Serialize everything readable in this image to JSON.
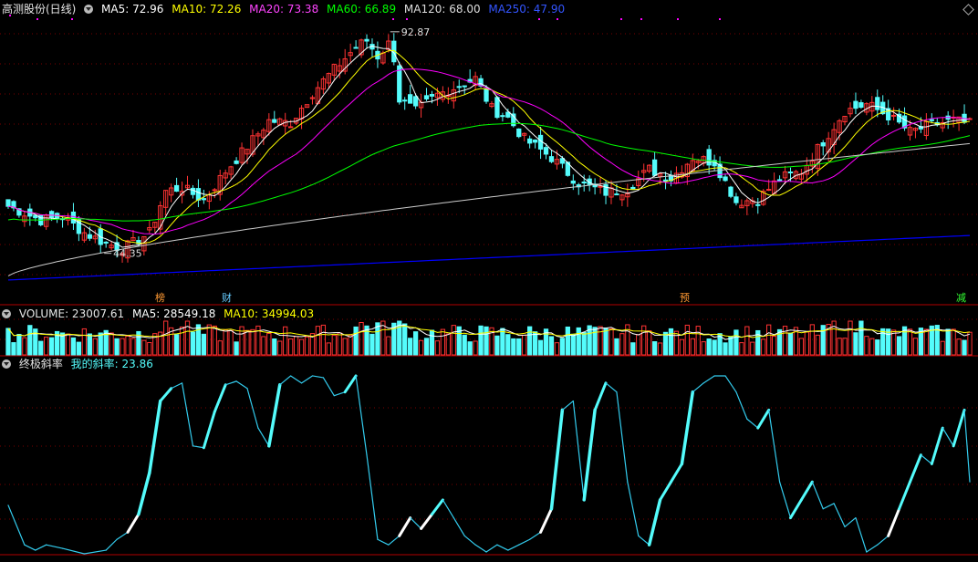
{
  "main_legend": {
    "title": "高测股份(日线)",
    "ma5": "MA5: 72.96",
    "ma10": "MA10: 72.26",
    "ma20": "MA20: 73.38",
    "ma60": "MA60: 66.89",
    "ma120": "MA120: 68.00",
    "ma250": "MA250: 47.90"
  },
  "volume_legend": {
    "volume": "VOLUME: 23007.61",
    "ma5": "MA5: 28549.18",
    "ma10": "MA10: 34994.03"
  },
  "indicator_legend": {
    "name": "终极斜率",
    "series": "我的斜率: 23.86"
  },
  "annotations": {
    "high": "92.87",
    "low": "44.35"
  },
  "events": [
    {
      "label": "榜",
      "color": "#ff9933"
    },
    {
      "label": "财",
      "color": "#66ccff"
    },
    {
      "label": "预",
      "color": "#ff9933"
    },
    {
      "label": "减",
      "color": "#33ff33"
    }
  ],
  "colors": {
    "up": "#ff3333",
    "down": "#54fcfc",
    "ma5": "#ffffff",
    "ma10": "#ffff00",
    "ma20": "#ff00ff",
    "ma60": "#00ff00",
    "ma120": "#cccccc",
    "ma250": "#0000ff",
    "indicator": "#33ccee",
    "indicator_strong": "#54fcfc",
    "grid": "#7a0000"
  },
  "chart_data": [
    {
      "type": "candlestick",
      "name": "高测股份(日线)",
      "high": 92.87,
      "low": 44.35,
      "moving_averages": {
        "MA5": 72.96,
        "MA10": 72.26,
        "MA20": 73.38,
        "MA60": 66.89,
        "MA120": 68.0,
        "MA250": 47.9
      },
      "close_path": [
        {
          "i": 0,
          "v": 54.5
        },
        {
          "i": 6,
          "v": 51.5
        },
        {
          "i": 10,
          "v": 52.2
        },
        {
          "i": 14,
          "v": 48.8
        },
        {
          "i": 18,
          "v": 46.5
        },
        {
          "i": 21,
          "v": 45.4
        },
        {
          "i": 23,
          "v": 46.6
        },
        {
          "i": 26,
          "v": 48.8
        },
        {
          "i": 29,
          "v": 57.8
        },
        {
          "i": 32,
          "v": 58.5
        },
        {
          "i": 36,
          "v": 55.8
        },
        {
          "i": 40,
          "v": 62.0
        },
        {
          "i": 44,
          "v": 67.4
        },
        {
          "i": 48,
          "v": 72.9
        },
        {
          "i": 52,
          "v": 72.5
        },
        {
          "i": 56,
          "v": 79.0
        },
        {
          "i": 60,
          "v": 84.0
        },
        {
          "i": 64,
          "v": 88.8
        },
        {
          "i": 66,
          "v": 90.2
        },
        {
          "i": 68,
          "v": 86.8
        },
        {
          "i": 70,
          "v": 89.5
        },
        {
          "i": 71,
          "v": 86.5
        },
        {
          "i": 72,
          "v": 77.5
        },
        {
          "i": 75,
          "v": 75.0
        },
        {
          "i": 79,
          "v": 78.5
        },
        {
          "i": 83,
          "v": 80.5
        },
        {
          "i": 86,
          "v": 82.0
        },
        {
          "i": 89,
          "v": 75.5
        },
        {
          "i": 92,
          "v": 73.5
        },
        {
          "i": 95,
          "v": 69.0
        },
        {
          "i": 100,
          "v": 65.0
        },
        {
          "i": 105,
          "v": 59.5
        },
        {
          "i": 110,
          "v": 57.5
        },
        {
          "i": 114,
          "v": 58.2
        },
        {
          "i": 118,
          "v": 62.5
        },
        {
          "i": 122,
          "v": 60.5
        },
        {
          "i": 126,
          "v": 65.0
        },
        {
          "i": 130,
          "v": 64.0
        },
        {
          "i": 134,
          "v": 55.5
        },
        {
          "i": 138,
          "v": 56.0
        },
        {
          "i": 142,
          "v": 60.5
        },
        {
          "i": 146,
          "v": 62.0
        },
        {
          "i": 150,
          "v": 68.5
        },
        {
          "i": 154,
          "v": 75.0
        },
        {
          "i": 158,
          "v": 76.5
        },
        {
          "i": 162,
          "v": 74.0
        },
        {
          "i": 166,
          "v": 70.5
        },
        {
          "i": 170,
          "v": 72.0
        },
        {
          "i": 174,
          "v": 73.0
        },
        {
          "i": 177,
          "v": 72.2
        }
      ]
    },
    {
      "type": "bar",
      "name": "VOLUME",
      "last": 23007.61,
      "MA5": 28549.18,
      "MA10": 34994.03
    },
    {
      "type": "line",
      "name": "我的斜率",
      "last": 23.86,
      "x": [
        0,
        3,
        5,
        7,
        10,
        14,
        18,
        20,
        22,
        24,
        26,
        28,
        30,
        32,
        34,
        36,
        38,
        40,
        42,
        44,
        46,
        48,
        50,
        52,
        54,
        56,
        58,
        60,
        62,
        64,
        66,
        68,
        70,
        72,
        74,
        76,
        78,
        80,
        82,
        84,
        86,
        88,
        90,
        92,
        94,
        96,
        98,
        100,
        102,
        104,
        106,
        108,
        110,
        112,
        114,
        116,
        118,
        120,
        122,
        124,
        126,
        128,
        130,
        132,
        134,
        136,
        138,
        140,
        142,
        144,
        146,
        148,
        150,
        152,
        154,
        156,
        158,
        160,
        162,
        164,
        166,
        168,
        170,
        172,
        174,
        176,
        177
      ],
      "values": [
        27,
        5,
        2,
        5,
        3,
        0,
        2,
        8,
        12,
        22,
        45,
        85,
        92,
        95,
        60,
        59,
        79,
        94,
        96,
        92,
        70,
        60,
        94,
        99,
        95,
        99,
        98,
        88,
        90,
        99,
        55,
        8,
        5,
        10,
        20,
        14,
        22,
        30,
        20,
        10,
        5,
        1,
        5,
        2,
        5,
        8,
        12,
        25,
        80,
        85,
        30,
        80,
        95,
        90,
        40,
        10,
        5,
        30,
        40,
        50,
        90,
        95,
        99,
        99,
        90,
        75,
        70,
        80,
        40,
        20,
        30,
        40,
        25,
        28,
        15,
        20,
        1,
        5,
        10,
        25,
        40,
        55,
        50,
        70,
        60,
        80,
        40
      ]
    }
  ]
}
